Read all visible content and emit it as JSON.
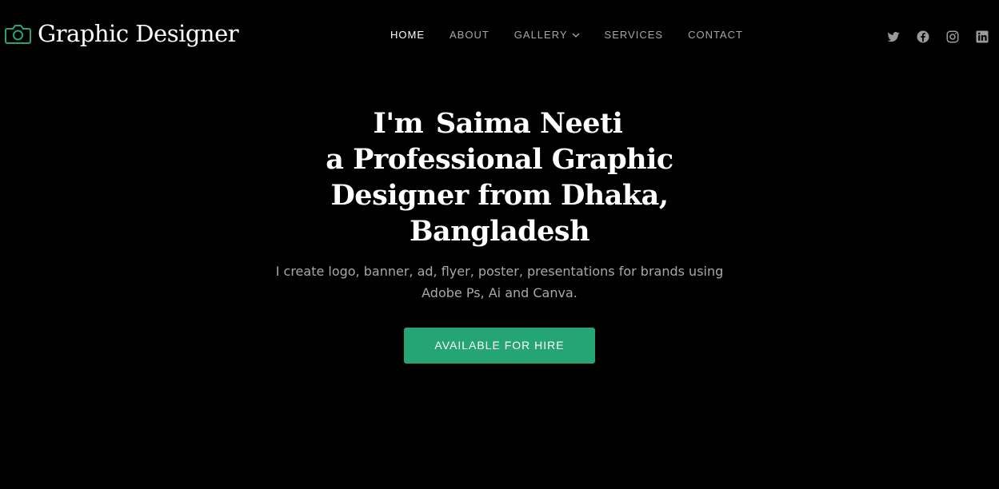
{
  "brand": {
    "logo_icon": "camera-icon",
    "name": "Graphic Designer",
    "accent_color": "#25a576"
  },
  "nav": {
    "items": [
      {
        "label": "HOME",
        "active": true
      },
      {
        "label": "ABOUT",
        "active": false
      },
      {
        "label": "GALLERY",
        "active": false,
        "has_dropdown": true,
        "dropdown_icon": "chevron-down-icon"
      },
      {
        "label": "SERVICES",
        "active": false
      },
      {
        "label": "CONTACT",
        "active": false
      }
    ]
  },
  "social": {
    "icons": [
      "twitter-icon",
      "facebook-icon",
      "instagram-icon",
      "linkedin-icon"
    ]
  },
  "hero": {
    "greeting": "I'm",
    "name": "Saima Neeti",
    "title_rest": "a Professional Graphic Designer from Dhaka, Bangladesh",
    "description": "I create logo, banner, ad, flyer, poster, presentations for brands using Adobe Ps, Ai and Canva.",
    "cta_label": "AVAILABLE FOR HIRE"
  }
}
